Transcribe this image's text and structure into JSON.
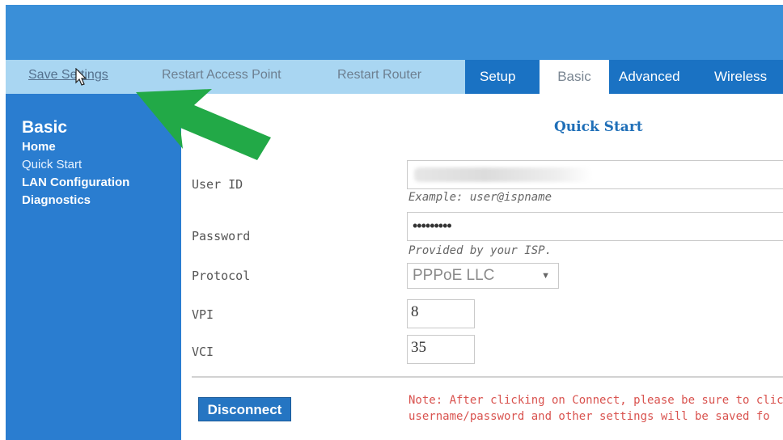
{
  "toolbar": {
    "save_settings": "Save Settings",
    "restart_access_point": "Restart Access Point",
    "restart_router": "Restart Router"
  },
  "tabs": [
    {
      "label": "Setup"
    },
    {
      "label": "Basic",
      "active": true
    },
    {
      "label": "Advanced"
    },
    {
      "label": "Wireless"
    }
  ],
  "sidebar": {
    "title": "Basic",
    "items": [
      {
        "label": "Home"
      },
      {
        "label": "Quick Start",
        "active": true
      },
      {
        "label": "LAN Configuration"
      },
      {
        "label": "Diagnostics"
      }
    ]
  },
  "main": {
    "title": "Quick Start",
    "fields": {
      "user_id": {
        "label": "User ID",
        "value": "",
        "hint": "Example: user@ispname"
      },
      "password": {
        "label": "Password",
        "value": "•••••••••",
        "hint": "Provided by your ISP."
      },
      "protocol": {
        "label": "Protocol",
        "value": "PPPoE LLC"
      },
      "vpi": {
        "label": "VPI",
        "value": "8"
      },
      "vci": {
        "label": "VCI",
        "value": "35"
      }
    },
    "disconnect_label": "Disconnect",
    "note_line1": "Note: After clicking on Connect, please be sure to click",
    "note_line2": "username/password and other settings will be saved fo"
  },
  "icons": {
    "annotation_arrow": "green-arrow-icon",
    "cursor": "mouse-pointer-icon",
    "dropdown": "dropdown-arrow-icon"
  },
  "colors": {
    "header_blue": "#3a8fd8",
    "toolbar_light_blue": "#a9d6f2",
    "tab_bar_blue": "#1a72c3",
    "sidebar_blue": "#2a7dd0",
    "annotation_green": "#22a947",
    "note_red": "#d9534f"
  }
}
